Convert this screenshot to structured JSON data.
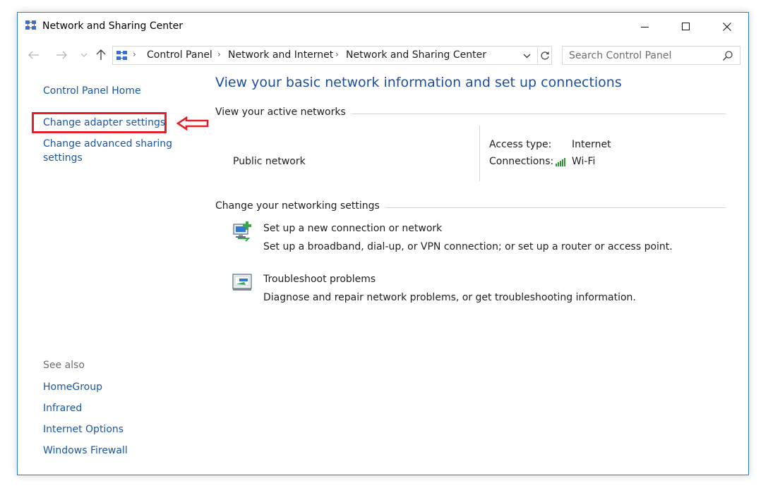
{
  "window": {
    "title": "Network and Sharing Center"
  },
  "navigation": {
    "breadcrumb": [
      "Control Panel",
      "Network and Internet",
      "Network and Sharing Center"
    ],
    "search_placeholder": "Search Control Panel"
  },
  "sidebar": {
    "home_link": "Control Panel Home",
    "links": [
      "Change adapter settings",
      "Change advanced sharing settings"
    ],
    "highlighted_item": "Change adapter settings",
    "highlight_color": "#e3202a",
    "see_also_label": "See also",
    "see_also_links": [
      "HomeGroup",
      "Infrared",
      "Internet Options",
      "Windows Firewall"
    ]
  },
  "main": {
    "heading": "View your basic network information and set up connections",
    "active_networks": {
      "section_label": "View your active networks",
      "network_name": "Public network",
      "access_type_label": "Access type:",
      "access_type_value": "Internet",
      "connections_label": "Connections:",
      "connection_name": "Wi-Fi",
      "connection_icon": "wifi-signal-icon"
    },
    "networking_settings": {
      "section_label": "Change your networking settings",
      "tasks": [
        {
          "icon": "new-connection-icon",
          "title": "Set up a new connection or network",
          "description": "Set up a broadband, dial-up, or VPN connection; or set up a router or access point."
        },
        {
          "icon": "troubleshoot-icon",
          "title": "Troubleshoot problems",
          "description": "Diagnose and repair network problems, or get troubleshooting information."
        }
      ]
    }
  },
  "colors": {
    "link": "#1a56a5",
    "heading": "#1c4fa0",
    "window_border": "#2b7bd0",
    "annotation": "#e3202a"
  }
}
